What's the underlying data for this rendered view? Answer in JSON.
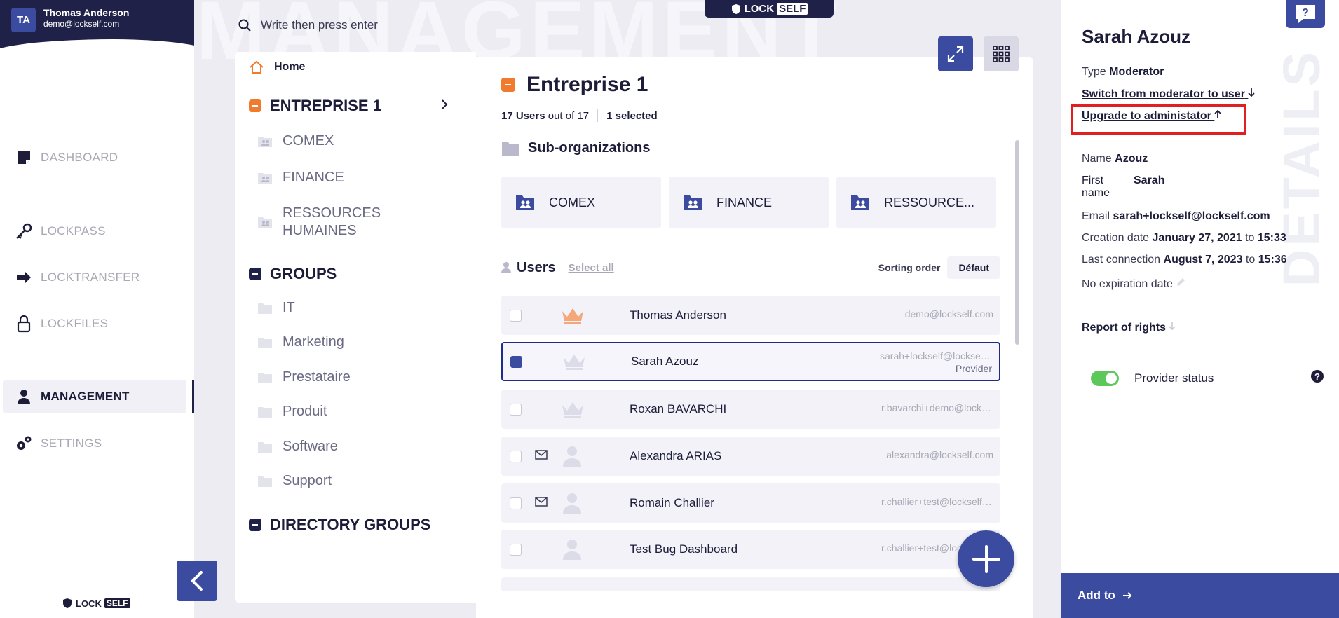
{
  "user": {
    "initials": "TA",
    "name": "Thomas Anderson",
    "email": "demo@lockself.com"
  },
  "nav": {
    "items": [
      {
        "label": "DASHBOARD",
        "icon": "dashboard-icon"
      },
      {
        "label": "LOCKPASS",
        "icon": "key-icon"
      },
      {
        "label": "LOCKTRANSFER",
        "icon": "arrow-right-icon"
      },
      {
        "label": "LOCKFILES",
        "icon": "lock-icon"
      },
      {
        "label": "MANAGEMENT",
        "icon": "person-icon"
      },
      {
        "label": "SETTINGS",
        "icon": "gears-icon"
      }
    ],
    "active": "MANAGEMENT"
  },
  "brand": {
    "lock": "LOCK",
    "self": "SELF"
  },
  "watermark": "MANAGEMENT",
  "search": {
    "placeholder": "Write then press enter"
  },
  "tree": {
    "home": "Home",
    "entreprise": "ENTREPRISE 1",
    "entreprise_children": [
      "COMEX",
      "FINANCE",
      "RESSOURCES HUMAINES"
    ],
    "groups": "GROUPS",
    "groups_children": [
      "IT",
      "Marketing",
      "Prestataire",
      "Produit",
      "Software",
      "Support"
    ],
    "directory_groups": "DIRECTORY GROUPS"
  },
  "main": {
    "title": "Entreprise 1",
    "users_count": "17 Users",
    "out_of": "out of 17",
    "selected": "1 selected",
    "suborg_title": "Sub-organizations",
    "suborgs": [
      "COMEX",
      "FINANCE",
      "RESSOURCE..."
    ],
    "users_title": "Users",
    "select_all": "Select all",
    "sorting_label": "Sorting order",
    "sorting_value": "Défaut",
    "users": [
      {
        "name": "Thomas Anderson",
        "email": "demo@lockself.com",
        "role": "admin",
        "checked": false,
        "invited": false,
        "tag": ""
      },
      {
        "name": "Sarah Azouz",
        "email": "sarah+lockself@lockself.com",
        "role": "moderator",
        "checked": true,
        "invited": false,
        "tag": "Provider"
      },
      {
        "name": "Roxan BAVARCHI",
        "email": "r.bavarchi+demo@lockself.com",
        "role": "moderator",
        "checked": false,
        "invited": false,
        "tag": ""
      },
      {
        "name": "Alexandra ARIAS",
        "email": "alexandra@lockself.com",
        "role": "user",
        "checked": false,
        "invited": true,
        "tag": ""
      },
      {
        "name": "Romain Challier",
        "email": "r.challier+test@lockself.com",
        "role": "user",
        "checked": false,
        "invited": true,
        "tag": ""
      },
      {
        "name": "Test Bug Dashboard",
        "email": "r.challier+test@lockself.com",
        "role": "user",
        "checked": false,
        "invited": false,
        "tag": ""
      }
    ]
  },
  "details": {
    "watermark": "DETAILS",
    "name": "Sarah Azouz",
    "type_label": "Type",
    "type_value": "Moderator",
    "switch_link": "Switch from moderator to user",
    "upgrade_link": "Upgrade to administator",
    "lastname_label": "Name",
    "lastname_value": "Azouz",
    "firstname_label": "First name",
    "firstname_value": "Sarah",
    "email_label": "Email",
    "email_value": "sarah+lockself@lockself.com",
    "creation_label": "Creation date",
    "creation_date": "January 27, 2021",
    "creation_to": "to",
    "creation_time": "15:33",
    "lastconn_label": "Last connection",
    "lastconn_date": "August 7, 2023",
    "lastconn_to": "to",
    "lastconn_time": "15:36",
    "expiration": "No expiration date",
    "report": "Report of rights",
    "provider_status": "Provider status",
    "provider_on": true,
    "add_to": "Add to"
  },
  "colors": {
    "primary": "#3a4ba0",
    "dark": "#1f2148",
    "accent_orange": "#f07a2e",
    "toggle_on": "#5cc85c",
    "highlight": "#e02020"
  }
}
